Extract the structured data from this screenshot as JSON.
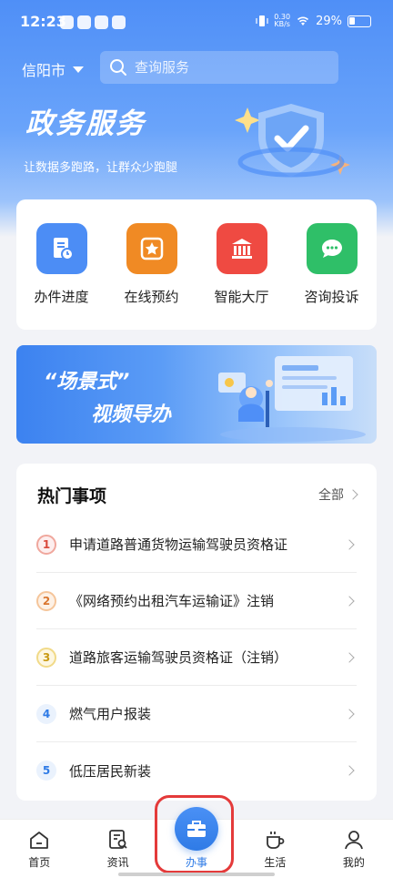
{
  "status_bar": {
    "time": "12:23",
    "net_speed_value": "0.30",
    "net_speed_unit": "KB/s",
    "battery": "29%"
  },
  "header": {
    "city": "信阳市",
    "search_placeholder": "查询服务"
  },
  "hero": {
    "title": "政务服务",
    "subtitle": "让数据多跑路，让群众少跑腿"
  },
  "services": [
    {
      "label": "办件进度",
      "icon": "progress-doc-icon",
      "color": "#4c8df5"
    },
    {
      "label": "在线预约",
      "icon": "star-appointment-icon",
      "color": "#f08a24"
    },
    {
      "label": "智能大厅",
      "icon": "building-hall-icon",
      "color": "#ef4a42"
    },
    {
      "label": "咨询投诉",
      "icon": "chat-bubble-icon",
      "color": "#2fbf68"
    }
  ],
  "banner": {
    "line1": "“场景式”",
    "line2": "视频导办"
  },
  "hot": {
    "title": "热门事项",
    "all_label": "全部",
    "items": [
      {
        "rank": "1",
        "text": "申请道路普通货物运输驾驶员资格证"
      },
      {
        "rank": "2",
        "text": "《网络预约出租汽车运输证》注销"
      },
      {
        "rank": "3",
        "text": "道路旅客运输驾驶员资格证（注销）"
      },
      {
        "rank": "4",
        "text": "燃气用户报装"
      },
      {
        "rank": "5",
        "text": "低压居民新装"
      }
    ]
  },
  "tabs": [
    {
      "label": "首页",
      "icon": "home-icon"
    },
    {
      "label": "资讯",
      "icon": "news-search-icon"
    },
    {
      "label": "办事",
      "icon": "briefcase-icon",
      "active": true
    },
    {
      "label": "生活",
      "icon": "coffee-cup-icon"
    },
    {
      "label": "我的",
      "icon": "person-icon"
    }
  ],
  "colors": {
    "brand_blue": "#2f7be6",
    "highlight_red": "#e43a3a"
  }
}
